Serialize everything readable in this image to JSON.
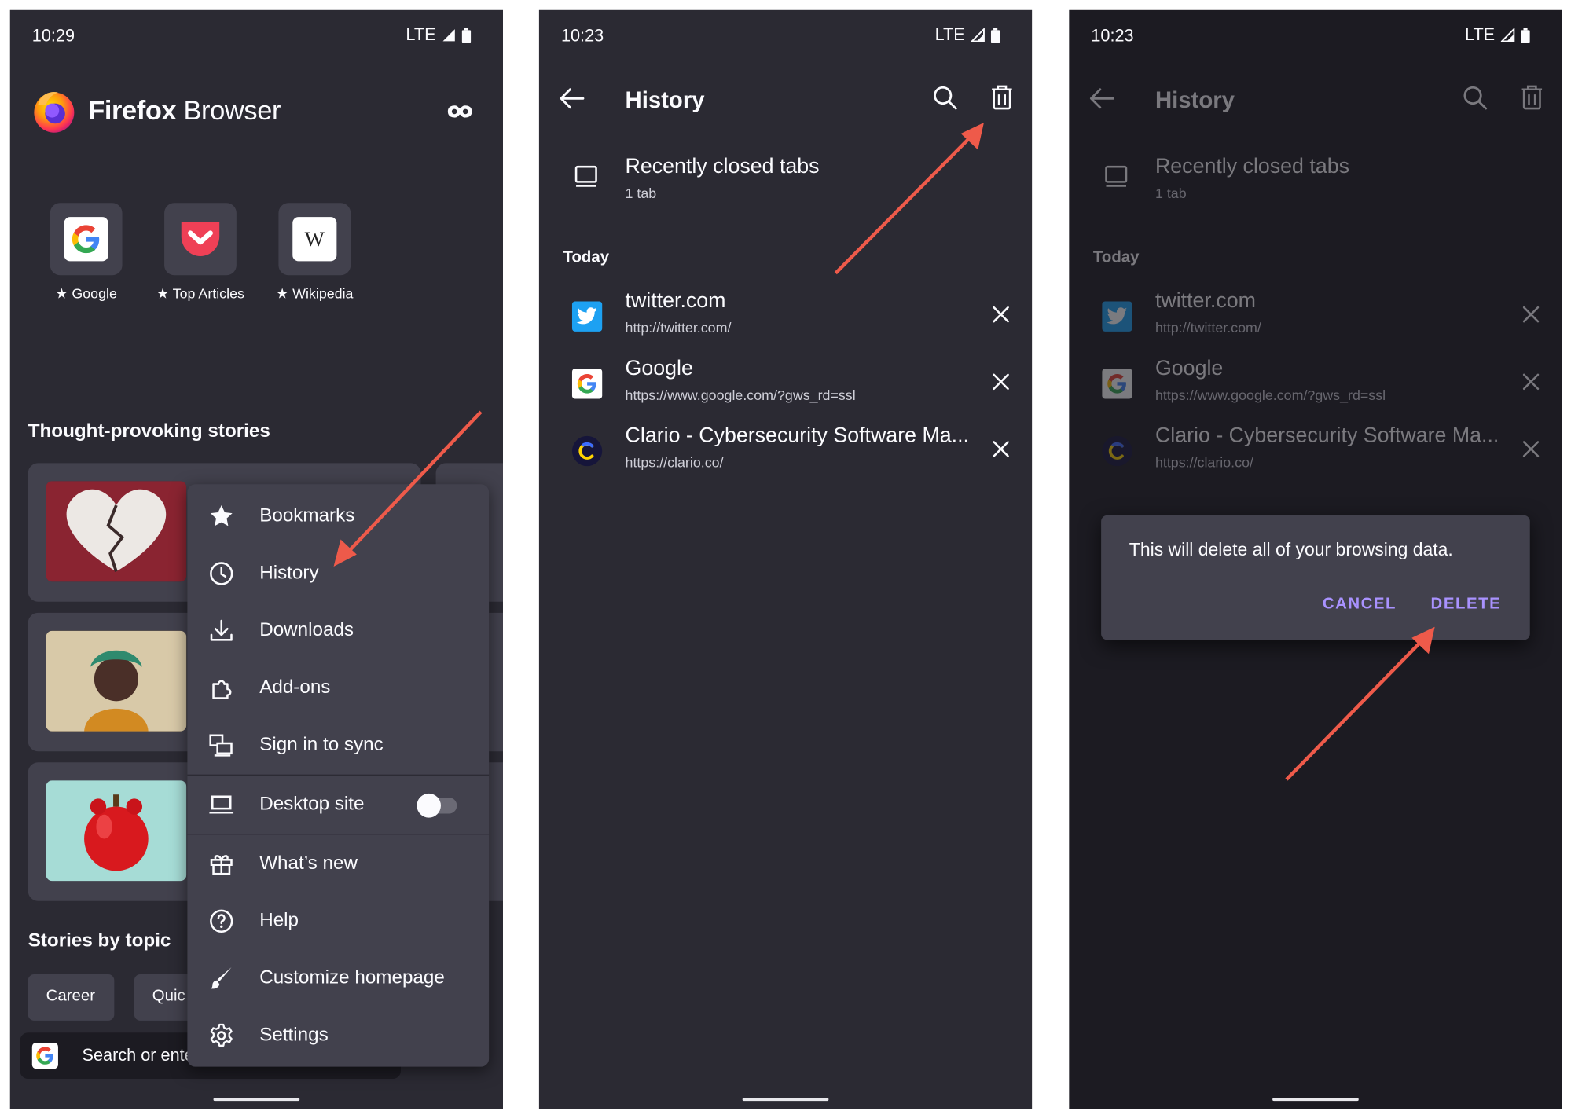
{
  "colors": {
    "accent": "#a992ff",
    "arrow": "#ee5a4a",
    "dark_bg": "#2b2a33",
    "surface": "#42414d",
    "dim_bg": "#1c1b22"
  },
  "screen1": {
    "time": "10:29",
    "network": "LTE",
    "brand_bold": "Firefox",
    "brand_light": " Browser",
    "shortcuts": [
      {
        "label": "Google",
        "icon": "google-icon"
      },
      {
        "label": "Top Articles",
        "icon": "pocket-icon"
      },
      {
        "label": "Wikipedia",
        "icon": "wikipedia-icon"
      }
    ],
    "stories_heading": "Thought-provoking stories",
    "topics_heading": "Stories by topic",
    "topic_chips": [
      "Career",
      "Quic"
    ],
    "search_placeholder": "Search or ente",
    "menu": {
      "items": [
        {
          "label": "Bookmarks",
          "icon": "star-icon"
        },
        {
          "label": "History",
          "icon": "clock-icon"
        },
        {
          "label": "Downloads",
          "icon": "download-icon"
        },
        {
          "label": "Add-ons",
          "icon": "puzzle-icon"
        },
        {
          "label": "Sign in to sync",
          "icon": "sync-devices-icon"
        },
        {
          "label": "Desktop site",
          "icon": "laptop-icon"
        },
        {
          "label": "What’s new",
          "icon": "gift-icon"
        },
        {
          "label": "Help",
          "icon": "help-icon"
        },
        {
          "label": "Customize homepage",
          "icon": "brush-icon"
        },
        {
          "label": "Settings",
          "icon": "gear-icon"
        }
      ],
      "desktop_site_enabled": false
    }
  },
  "screen2": {
    "time": "10:23",
    "network": "LTE",
    "title": "History",
    "recently_closed": {
      "title": "Recently closed tabs",
      "count": "1 tab"
    },
    "section": "Today",
    "entries": [
      {
        "title": "twitter.com",
        "url": "http://twitter.com/",
        "icon": "twitter-icon"
      },
      {
        "title": "Google",
        "url": "https://www.google.com/?gws_rd=ssl",
        "icon": "google-icon"
      },
      {
        "title": "Clario - Cybersecurity Software Ma...",
        "url": "https://clario.co/",
        "icon": "clario-icon"
      }
    ]
  },
  "screen3": {
    "time": "10:23",
    "network": "LTE",
    "title": "History",
    "recently_closed": {
      "title": "Recently closed tabs",
      "count": "1 tab"
    },
    "section": "Today",
    "entries": [
      {
        "title": "twitter.com",
        "url": "http://twitter.com/",
        "icon": "twitter-icon"
      },
      {
        "title": "Google",
        "url": "https://www.google.com/?gws_rd=ssl",
        "icon": "google-icon"
      },
      {
        "title": "Clario - Cybersecurity Software Ma...",
        "url": "https://clario.co/",
        "icon": "clario-icon"
      }
    ],
    "dialog": {
      "message": "This will delete all of your browsing data.",
      "cancel": "CANCEL",
      "delete": "DELETE"
    }
  }
}
